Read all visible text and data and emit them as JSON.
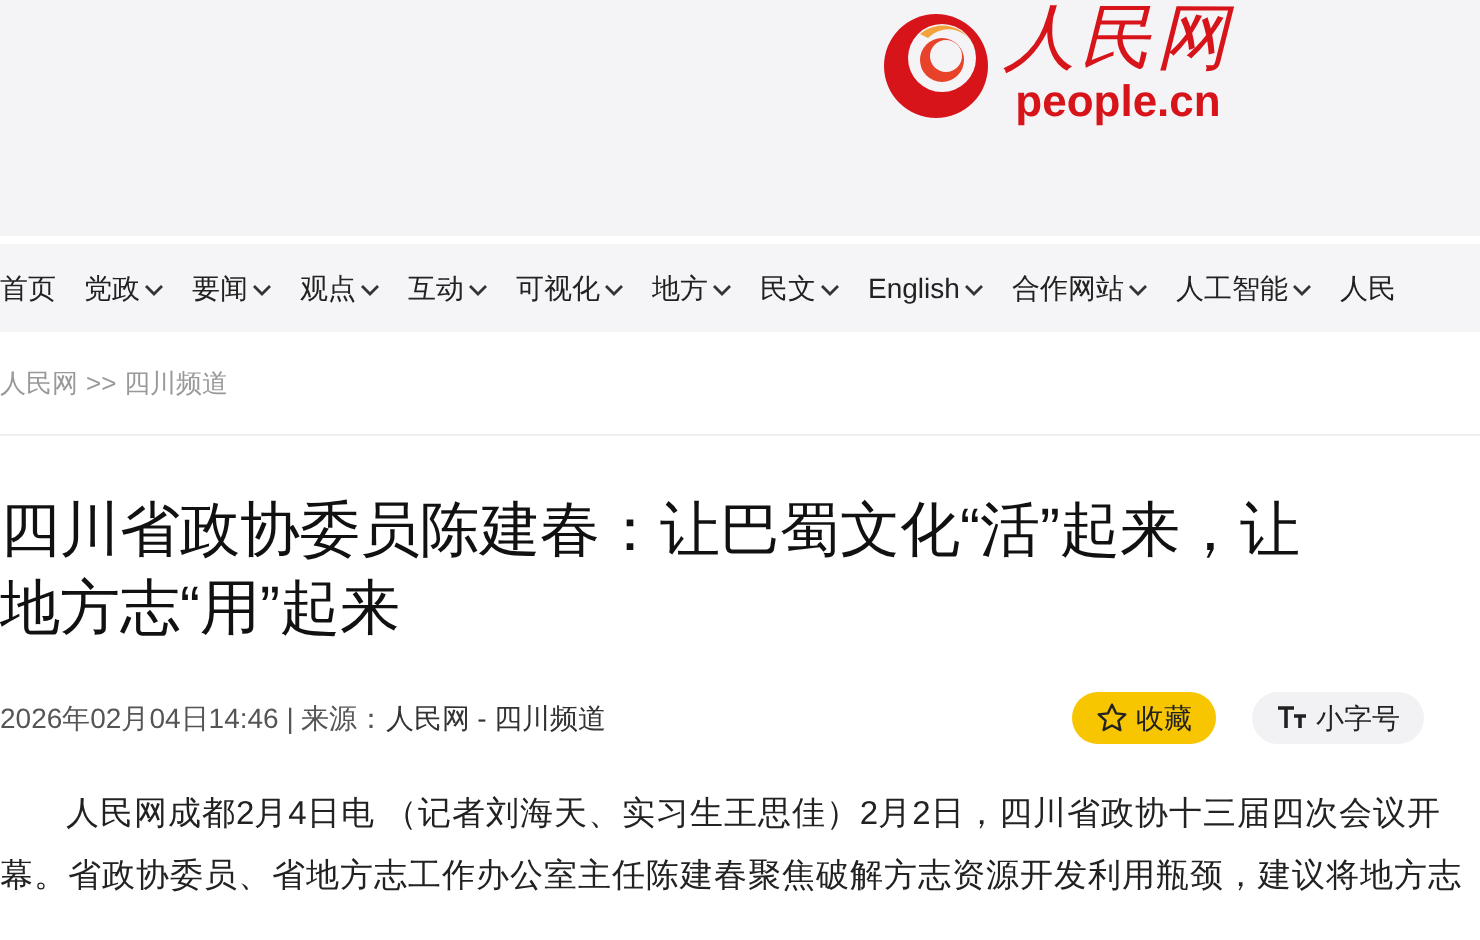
{
  "logo": {
    "name": "人民网",
    "domain": "people.cn"
  },
  "nav": [
    {
      "label": "首页",
      "dropdown": false
    },
    {
      "label": "党政",
      "dropdown": true
    },
    {
      "label": "要闻",
      "dropdown": true
    },
    {
      "label": "观点",
      "dropdown": true
    },
    {
      "label": "互动",
      "dropdown": true
    },
    {
      "label": "可视化",
      "dropdown": true
    },
    {
      "label": "地方",
      "dropdown": true
    },
    {
      "label": "民文",
      "dropdown": true
    },
    {
      "label": "English",
      "dropdown": true
    },
    {
      "label": "合作网站",
      "dropdown": true
    },
    {
      "label": "人工智能",
      "dropdown": true
    },
    {
      "label": "人民",
      "dropdown": false
    }
  ],
  "breadcrumb": [
    "人民网",
    ">>",
    "四川频道"
  ],
  "article": {
    "title": "四川省政协委员陈建春：让巴蜀文化“活”起来，让地方志“用”起来",
    "meta": "2026年02月04日14:46 | 来源：",
    "source": "人民网 - 四川频道",
    "actions": [
      {
        "kind": "favorite",
        "label": "收藏"
      },
      {
        "kind": "font-size",
        "label": "小字号"
      }
    ],
    "body": "人民网成都2月4日电 （记者刘海天、实习生王思佳）2月2日，四川省政协十三届四次会议开幕。省政协委员、省地方志工作办公室主任陈建春聚焦破解方志资源开发利用瓶颈，建议将地方志"
  }
}
